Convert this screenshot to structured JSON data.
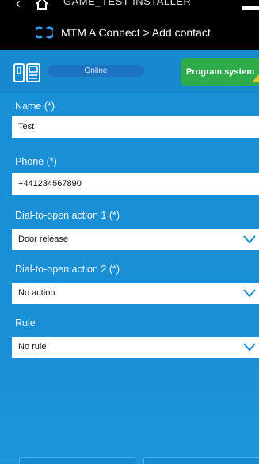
{
  "header": {
    "top_title": "GAME_TEST INSTALLER",
    "breadcrumb": "MTM A Connect > Add contact"
  },
  "status": {
    "online_label": "Online",
    "program_button": "Program system"
  },
  "form": {
    "name": {
      "label": "Name (*)",
      "value": "Test"
    },
    "phone": {
      "label": "Phone (*)",
      "value": "+441234567890"
    },
    "action1": {
      "label": "Dial-to-open action 1 (*)",
      "value": "Door release"
    },
    "action2": {
      "label": "Dial-to-open action 2 (*)",
      "value": "No action"
    },
    "rule": {
      "label": "Rule",
      "value": "No rule"
    }
  },
  "colors": {
    "header_bg": "#000000",
    "page_bg": "#1a8fd6",
    "program_button": "#2eab4b",
    "online_pill": "#1e74c0",
    "chevron": "#1a8fd6"
  },
  "icons": [
    "back-icon",
    "home-icon",
    "menu-icon",
    "cloud-link-icon",
    "intercom-device-icon",
    "chevron-down-icon"
  ]
}
